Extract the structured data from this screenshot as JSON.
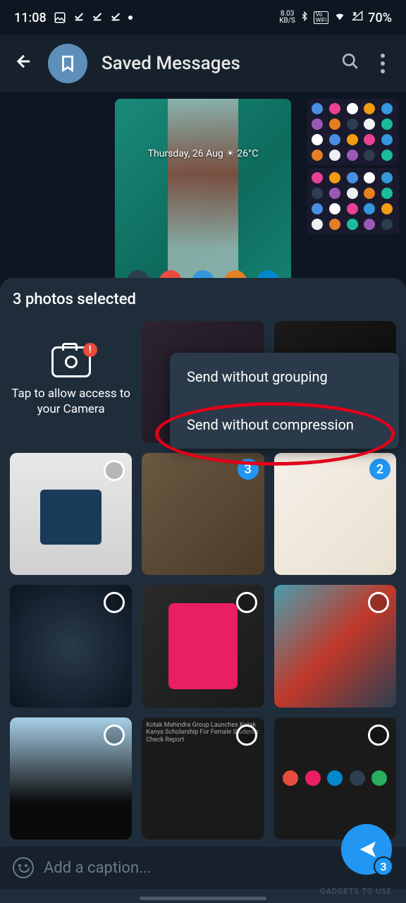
{
  "status": {
    "time": "11:08",
    "net_speed": "8.03",
    "net_unit": "KB/S",
    "vowifi": "VoWiFi",
    "battery": "70%"
  },
  "header": {
    "title": "Saved Messages"
  },
  "chat": {
    "date_weather": "Thursday, 26 Aug ☀ 26°C"
  },
  "picker": {
    "title": "3 photos selected",
    "camera_access": "Tap to allow access to your Camera",
    "camera_badge": "!",
    "badge_3": "3",
    "badge_2": "2",
    "news_text": "Kotak Mahindra Group Launches Kotak Kanya Scholarship For Female Students: Check Report"
  },
  "menu": {
    "item1": "Send without grouping",
    "item2": "Send without compression"
  },
  "caption": {
    "placeholder": "Add a caption..."
  },
  "fab": {
    "count": "3"
  },
  "watermark": "GADGETS TO USE"
}
